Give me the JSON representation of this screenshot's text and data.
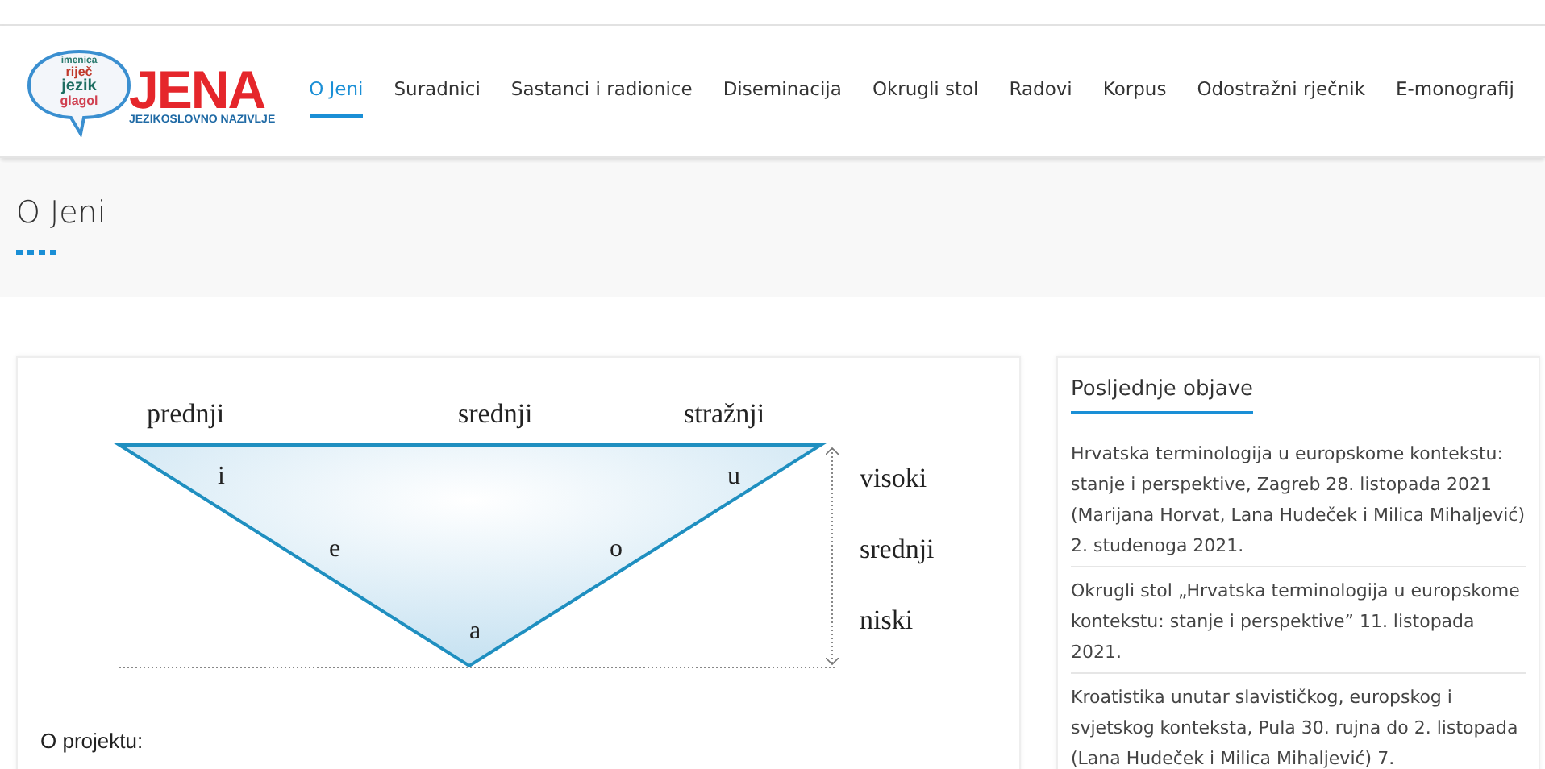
{
  "logo": {
    "title": "JENA",
    "subtitle": "JEZIKOSLOVNO NAZIVLJE",
    "cloud_words": [
      "imenica",
      "riječ",
      "jezik",
      "glagol"
    ]
  },
  "nav": [
    {
      "label": "O Jeni",
      "selected": true
    },
    {
      "label": "Suradnici",
      "selected": false
    },
    {
      "label": "Sastanci i radionice",
      "selected": false
    },
    {
      "label": "Diseminacija",
      "selected": false
    },
    {
      "label": "Okrugli stol",
      "selected": false
    },
    {
      "label": "Radovi",
      "selected": false
    },
    {
      "label": "Korpus",
      "selected": false
    },
    {
      "label": "Odostražni rječnik",
      "selected": false
    },
    {
      "label": "E-monografij",
      "selected": false
    }
  ],
  "page_title": "O Jeni",
  "diagram": {
    "columns": [
      "prednji",
      "srednji",
      "stražnji"
    ],
    "rows": [
      "visoki",
      "srednji",
      "niski"
    ],
    "vowels": [
      "i",
      "u",
      "e",
      "o",
      "a"
    ]
  },
  "section_heading": "O projektu:",
  "sidebar": {
    "title": "Posljednje objave",
    "posts": [
      "Hrvatska terminologija u europskome kontekstu: stanje i perspektive, Zagreb 28. listopada 2021 (Marijana Horvat, Lana Hudeček i Milica Mihaljević) 2. studenoga 2021.",
      "Okrugli stol „Hrvatska terminologija u europskome kontekstu: stanje i perspektive” 11. listopada 2021.",
      "Kroatistika unutar slavističkog, europskog i svjetskog konteksta, Pula 30. rujna do 2. listopada (Lana Hudeček i Milica Mihaljević) 7."
    ]
  }
}
